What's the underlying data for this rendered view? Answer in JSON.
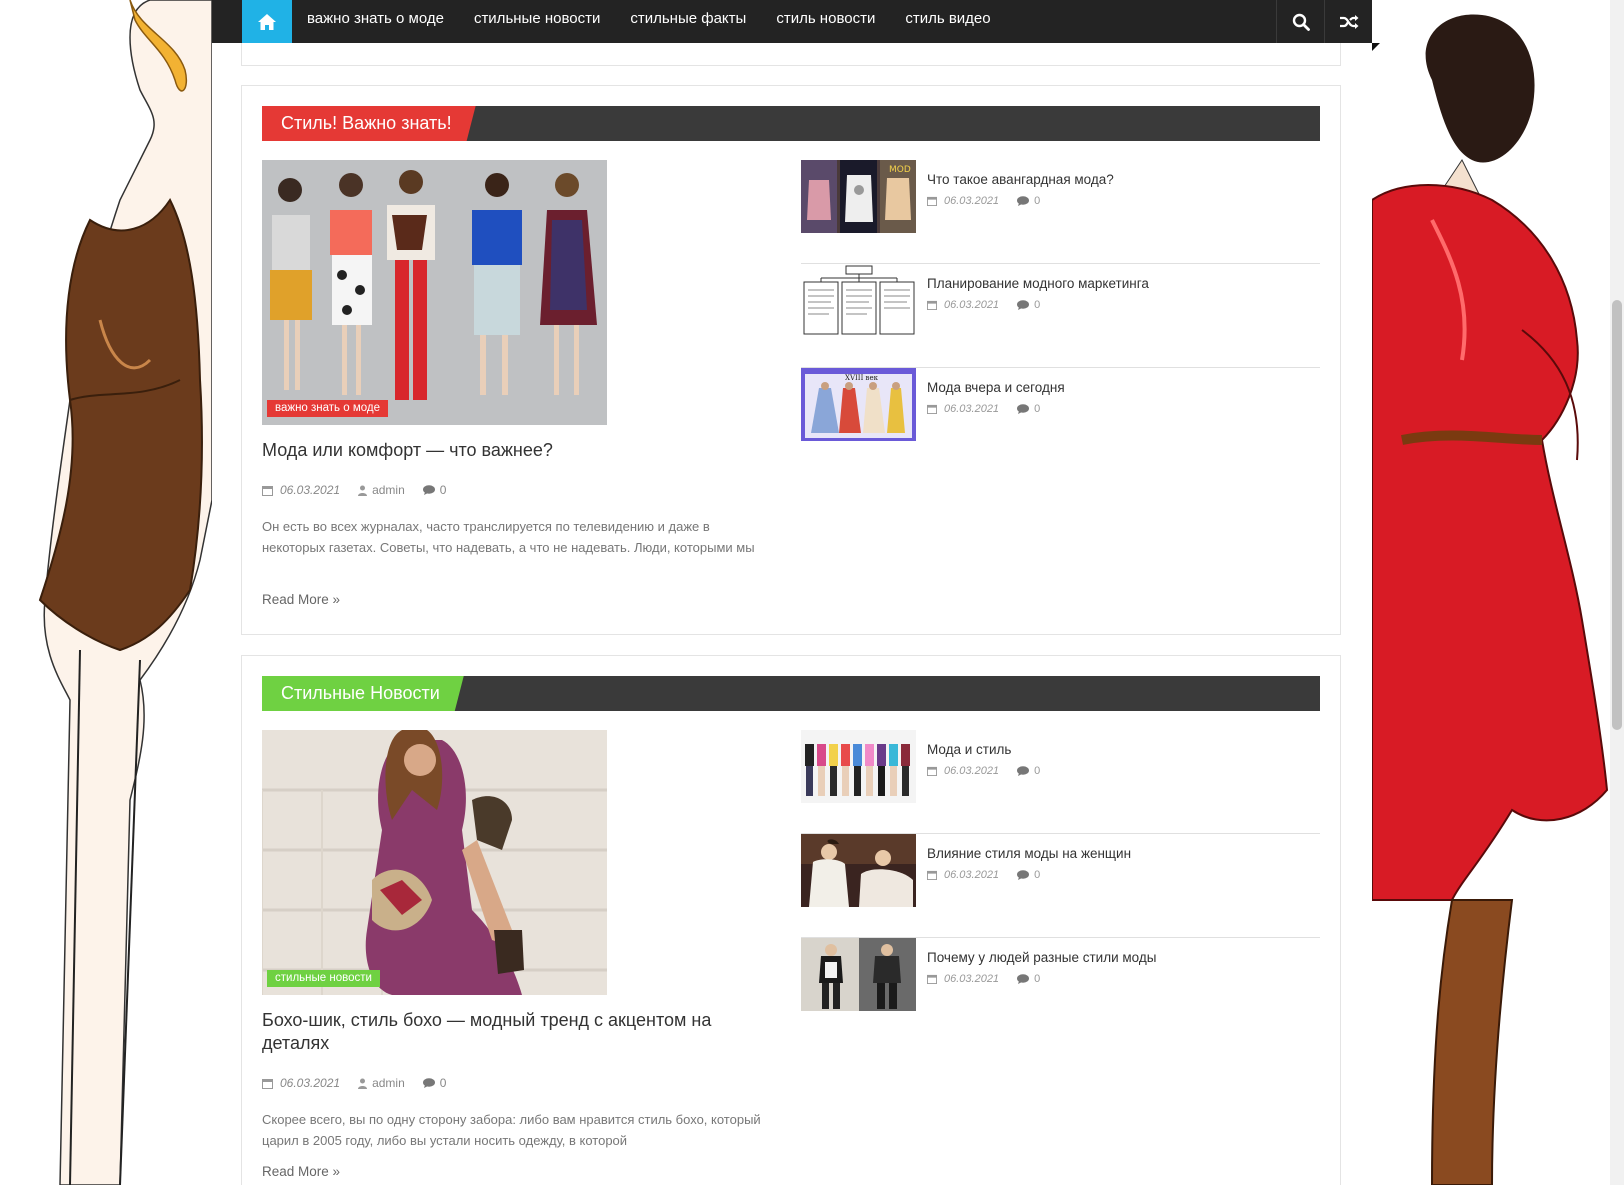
{
  "nav": {
    "items": [
      "важно знать о моде",
      "стильные новости",
      "стильные факты",
      "стиль новости",
      "стиль видео"
    ],
    "icons": [
      "home-icon",
      "search-icon",
      "random-icon"
    ],
    "accent": "#20b2e6",
    "background": "#232323"
  },
  "sections": [
    {
      "heading": "Стиль! Важно знать!",
      "heading_color": "#e53935",
      "featured": {
        "category": "важно знать о моде",
        "title": "Мода или комфорт — что важнее?",
        "date": "06.03.2021",
        "author": "admin",
        "comments": "0",
        "excerpt": "Он есть во всех журналах, часто транслируется по телевидению и даже в некоторых газетах. Советы, что надевать, а что не надевать. Люди, которыми мы",
        "read_more": "Read More »"
      },
      "side": [
        {
          "title": "Что такое авангардная мода?",
          "date": "06.03.2021",
          "comments": "0"
        },
        {
          "title": "Планирование модного маркетинга",
          "date": "06.03.2021",
          "comments": "0"
        },
        {
          "title": "Мода вчера и сегодня",
          "date": "06.03.2021",
          "comments": "0"
        }
      ]
    },
    {
      "heading": "Стильные Новости",
      "heading_color": "#6fd142",
      "featured": {
        "category": "стильные новости",
        "title": "Бохо-шик, стиль бохо — модный тренд с акцентом на деталях",
        "date": "06.03.2021",
        "author": "admin",
        "comments": "0",
        "excerpt": "Скорее всего, вы по одну сторону забора: либо вам нравится стиль бохо, который царил в 2005 году, либо вы устали носить одежду, в которой",
        "read_more": "Read More »"
      },
      "side": [
        {
          "title": "Мода и стиль",
          "date": "06.03.2021",
          "comments": "0"
        },
        {
          "title": "Влияние стиля моды на женщин",
          "date": "06.03.2021",
          "comments": "0"
        },
        {
          "title": "Почему у людей разные стили моды",
          "date": "06.03.2021",
          "comments": "0"
        }
      ]
    }
  ]
}
